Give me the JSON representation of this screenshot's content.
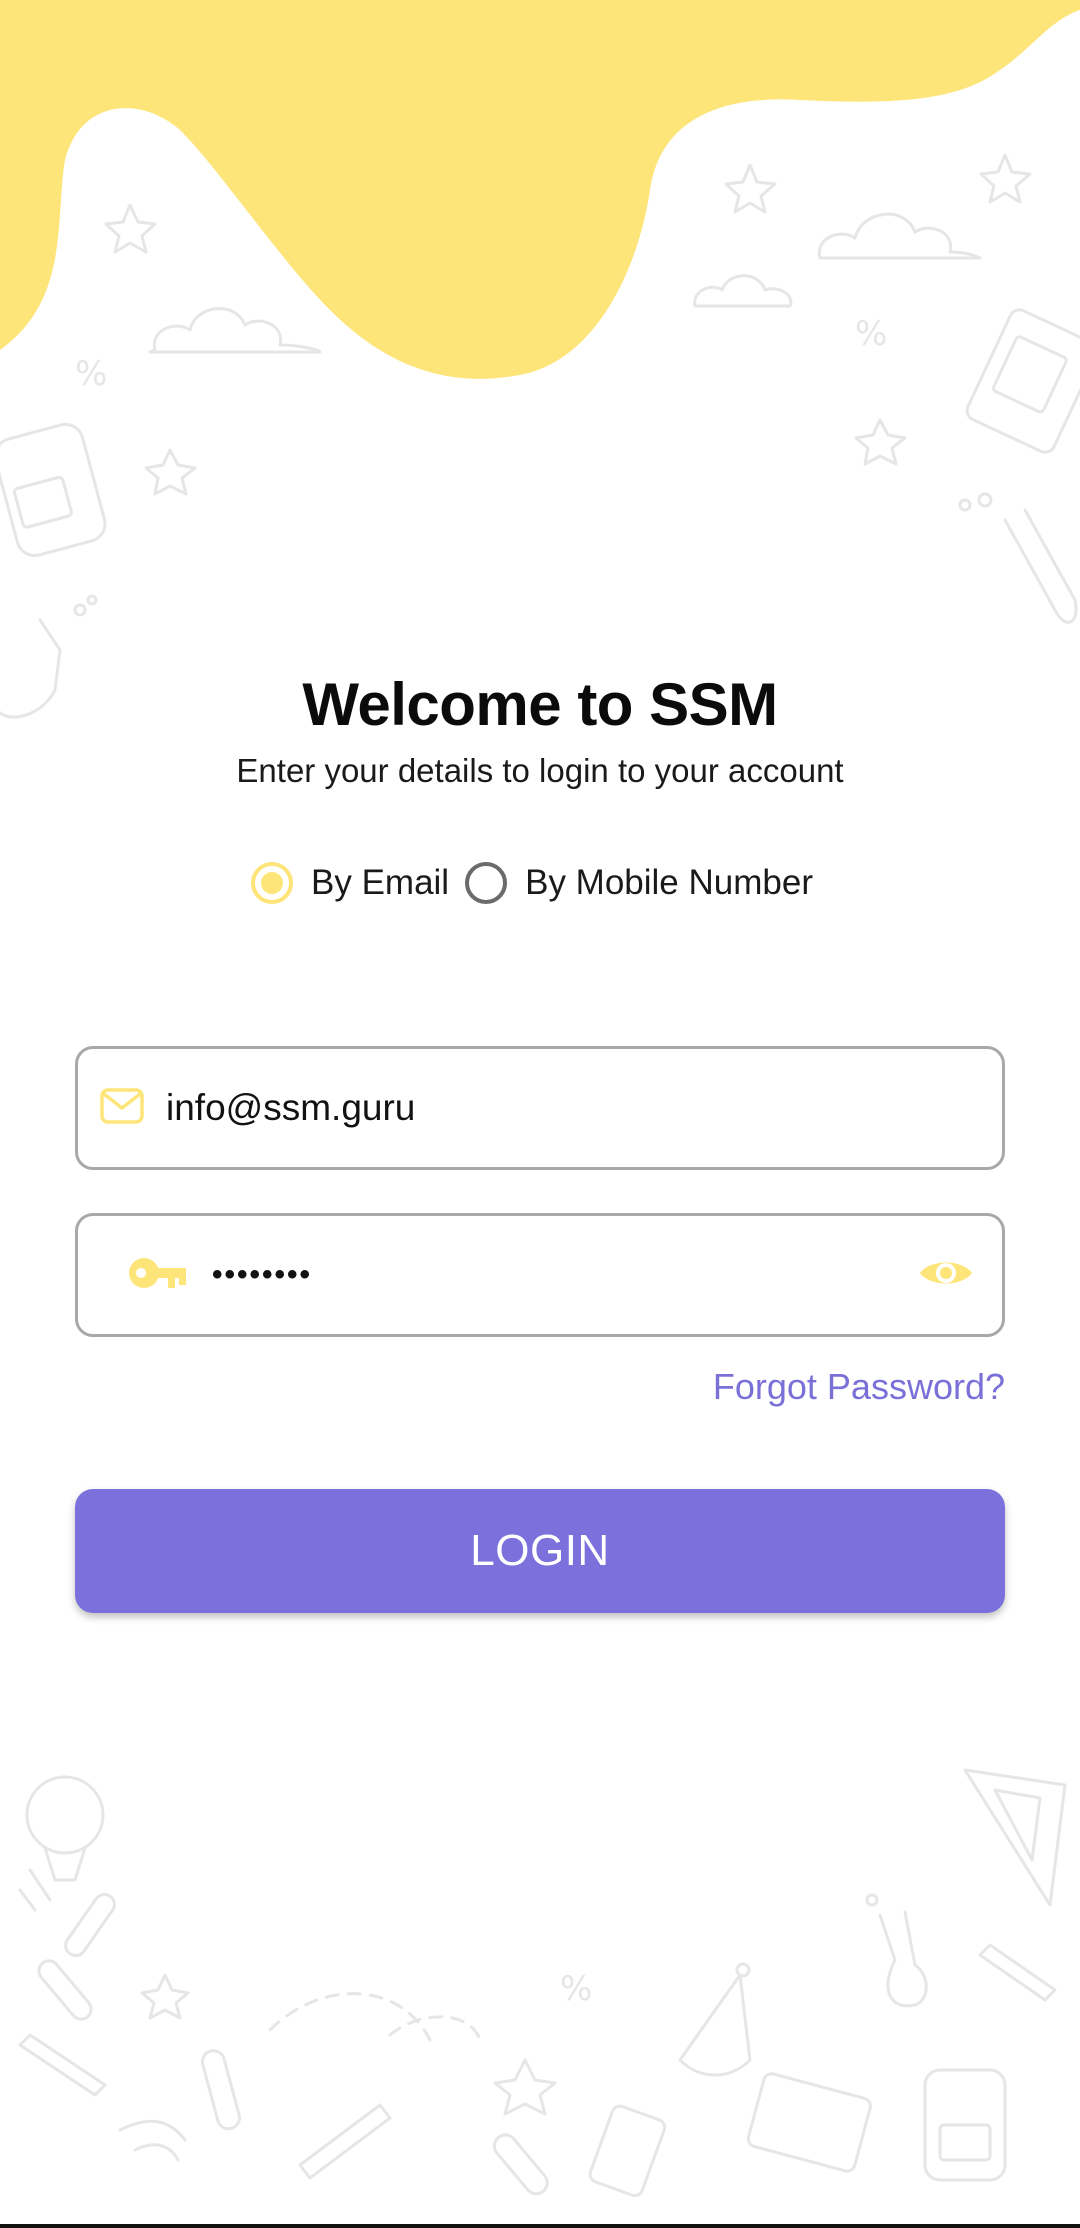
{
  "header": {
    "title": "Welcome to SSM",
    "subtitle": "Enter your details to login to your account"
  },
  "login_method": {
    "options": [
      {
        "label": "By Email",
        "selected": true
      },
      {
        "label": "By Mobile Number",
        "selected": false
      }
    ]
  },
  "email_field": {
    "value": "info@ssm.guru",
    "icon": "mail-icon"
  },
  "password_field": {
    "value": "••••••••",
    "icon": "key-icon",
    "toggle_icon": "eye-icon"
  },
  "links": {
    "forgot_password": "Forgot Password?"
  },
  "buttons": {
    "login": "LOGIN"
  },
  "colors": {
    "accent_yellow": "#fde57a",
    "primary_purple": "#7c71dc",
    "link_purple": "#7b70d8"
  }
}
